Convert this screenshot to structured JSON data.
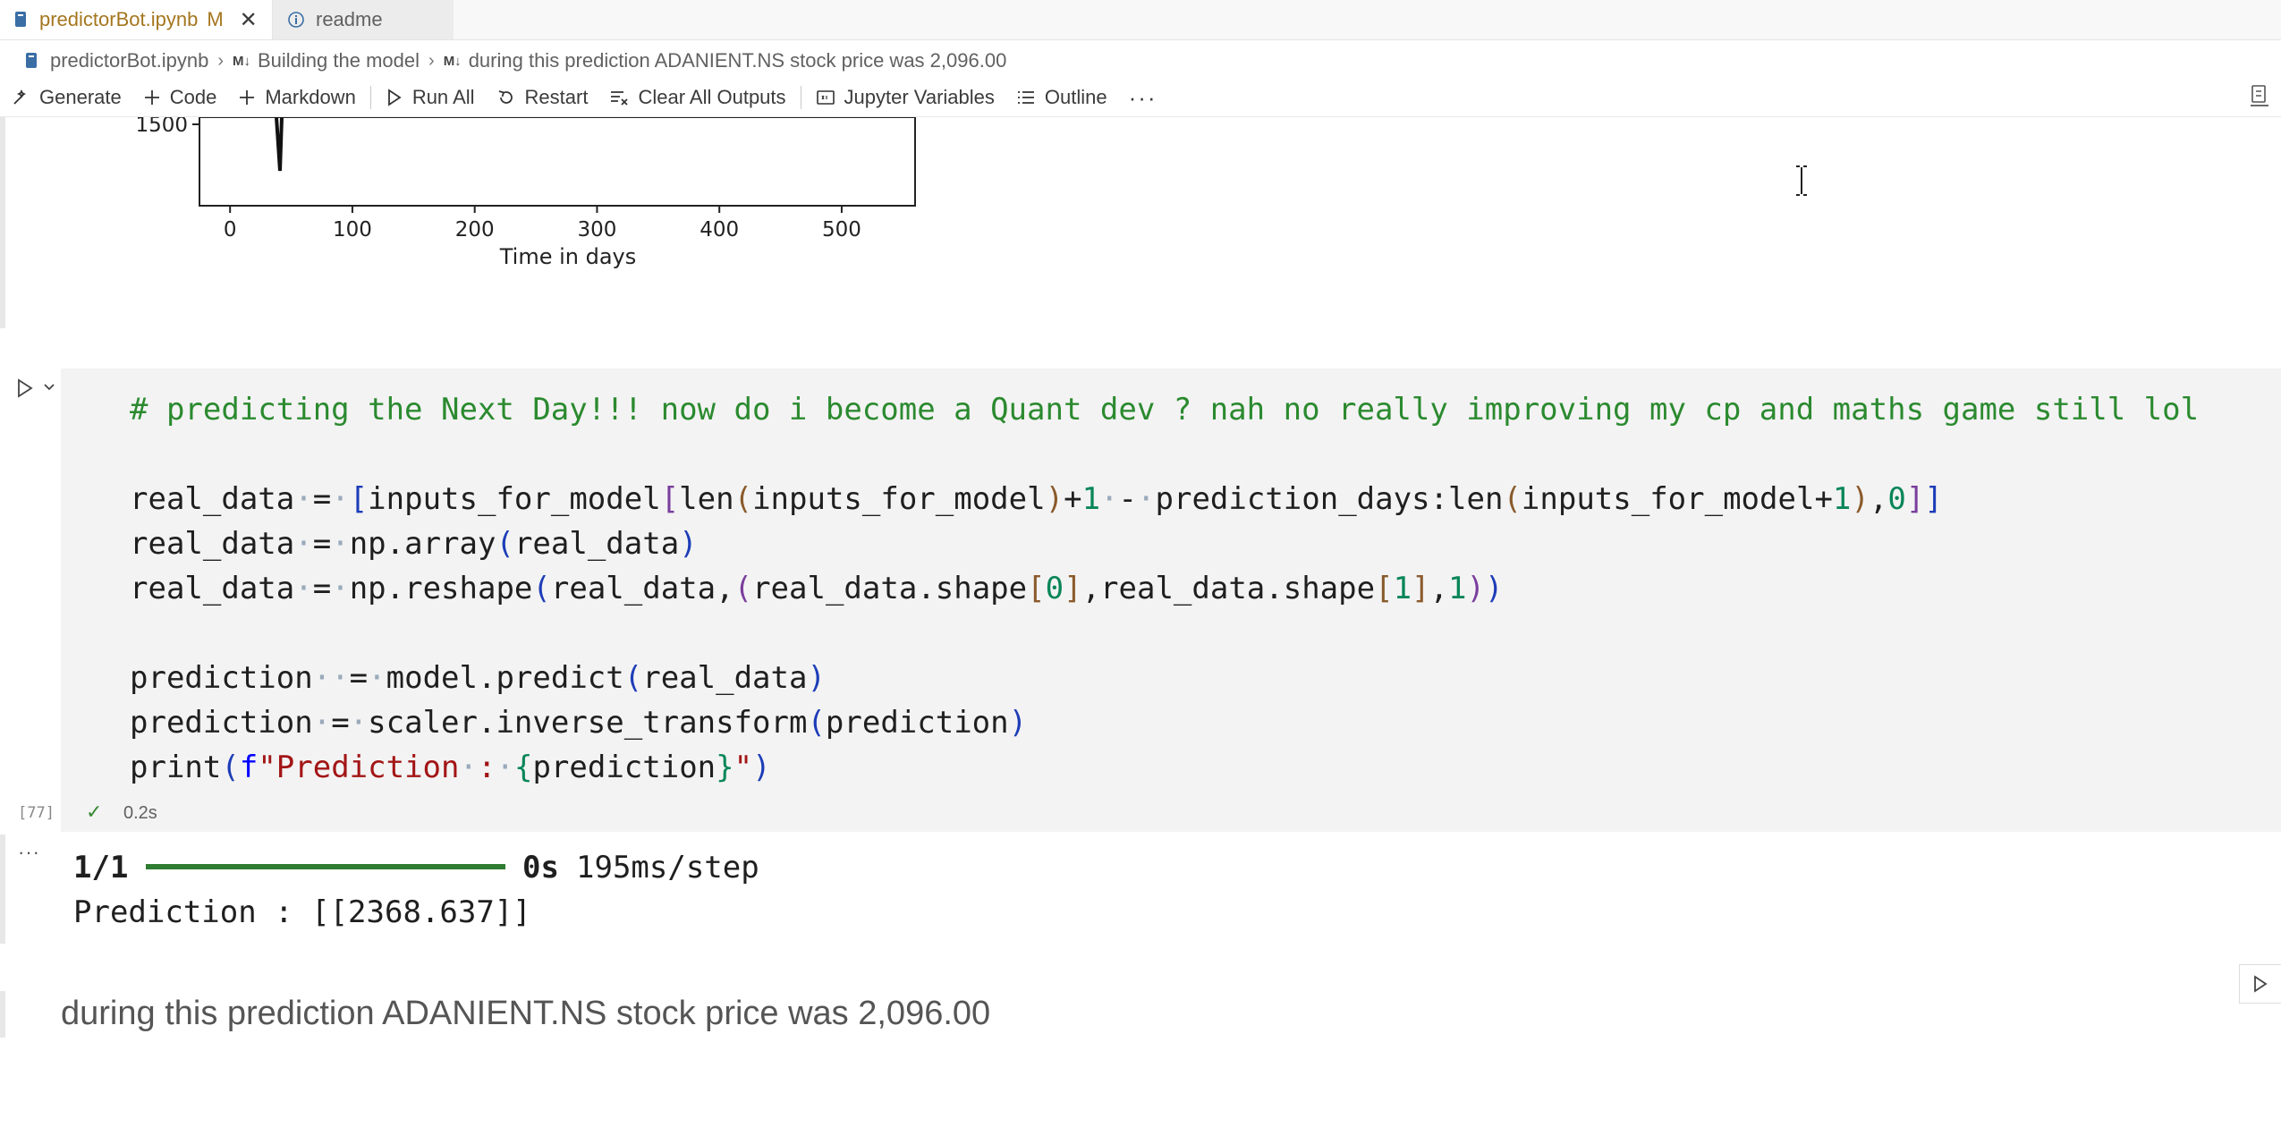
{
  "tabs": [
    {
      "label": "predictorBot.ipynb",
      "modified": "M",
      "active": true
    },
    {
      "label": "readme",
      "active": false
    }
  ],
  "breadcrumb": {
    "file": "predictorBot.ipynb",
    "md_marker": "M↓",
    "section": "Building the model",
    "cell": "during this prediction ADANIENT.NS stock price was 2,096.00"
  },
  "toolbar": {
    "generate": "Generate",
    "code": "Code",
    "markdown": "Markdown",
    "run_all": "Run All",
    "restart": "Restart",
    "clear_outputs": "Clear All Outputs",
    "jupyter_variables": "Jupyter Variables",
    "outline": "Outline",
    "more": "···"
  },
  "chart_data": {
    "type": "line",
    "xlabel": "Time in days",
    "xticks": [
      "0",
      "100",
      "200",
      "300",
      "400",
      "500"
    ],
    "yticks_visible": [
      "1500"
    ],
    "xlim": [
      -25,
      560
    ]
  },
  "code_cell": {
    "comment": "# predicting the Next Day!!! now do i become a Quant dev ? nah no really improving my cp and maths game still lol",
    "exec_count": "[77]",
    "duration": "0.2s"
  },
  "output": {
    "progress_label": "1/1",
    "progress": 1.0,
    "time": "0s",
    "rate": "195ms/step",
    "prediction_line": "Prediction : [[2368.637]]",
    "more": "···"
  },
  "markdown": {
    "text": "during this prediction ADANIENT.NS stock price was 2,096.00"
  }
}
